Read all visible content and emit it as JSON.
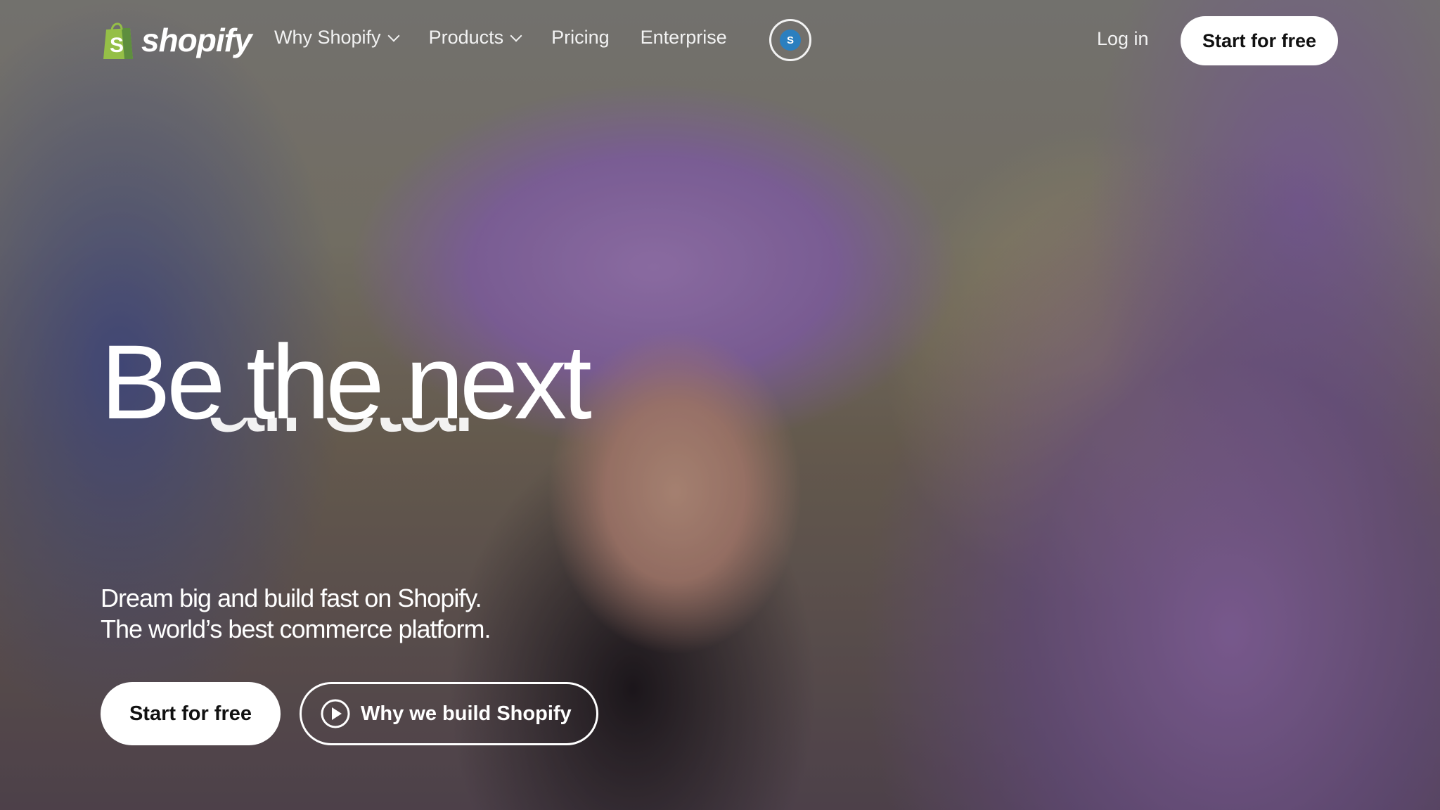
{
  "brand": {
    "name": "shopify",
    "logo_color": "#95bf47"
  },
  "nav": {
    "items": [
      {
        "label": "Why Shopify",
        "has_dropdown": true
      },
      {
        "label": "Products",
        "has_dropdown": true
      },
      {
        "label": "Pricing",
        "has_dropdown": false
      },
      {
        "label": "Enterprise",
        "has_dropdown": false
      }
    ],
    "shop_icon": "shop-app-icon",
    "login_label": "Log in",
    "start_label": "Start for free"
  },
  "hero": {
    "headline": "Be the next",
    "headline_next_word": "all star",
    "subtitle_line1": "Dream big and build fast on Shopify.",
    "subtitle_line2": "The world’s best commerce platform.",
    "cta_primary": "Start for free",
    "cta_secondary": "Why we build Shopify",
    "cta_secondary_icon": "play-circle-icon"
  }
}
